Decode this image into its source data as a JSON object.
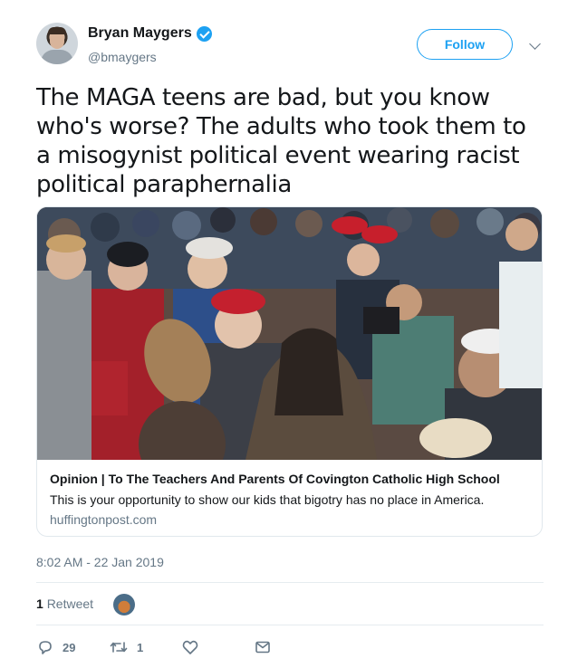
{
  "author": {
    "display_name": "Bryan Maygers",
    "handle": "@bmaygers",
    "verified": true
  },
  "header": {
    "follow_label": "Follow"
  },
  "tweet": {
    "text": "The MAGA teens are bad, but you know who's worse? The adults who took them to a misogynist political event wearing racist political paraphernalia"
  },
  "card": {
    "title": "Opinion | To The Teachers And Parents Of Covington Catholic High School",
    "description": "This is your opportunity to show our kids that bigotry has no place in America.",
    "domain": "huffingtonpost.com"
  },
  "meta": {
    "timestamp": "8:02 AM - 22 Jan 2019"
  },
  "stats": {
    "retweet_count": "1",
    "retweet_label": "Retweet"
  },
  "actions": {
    "reply_count": "29",
    "retweet_count": "1",
    "icons": [
      "reply-icon",
      "retweet-icon",
      "like-icon",
      "direct-message-icon"
    ]
  },
  "colors": {
    "accent": "#1da1f2",
    "secondary_text": "#657786",
    "border": "#e1e8ed"
  }
}
